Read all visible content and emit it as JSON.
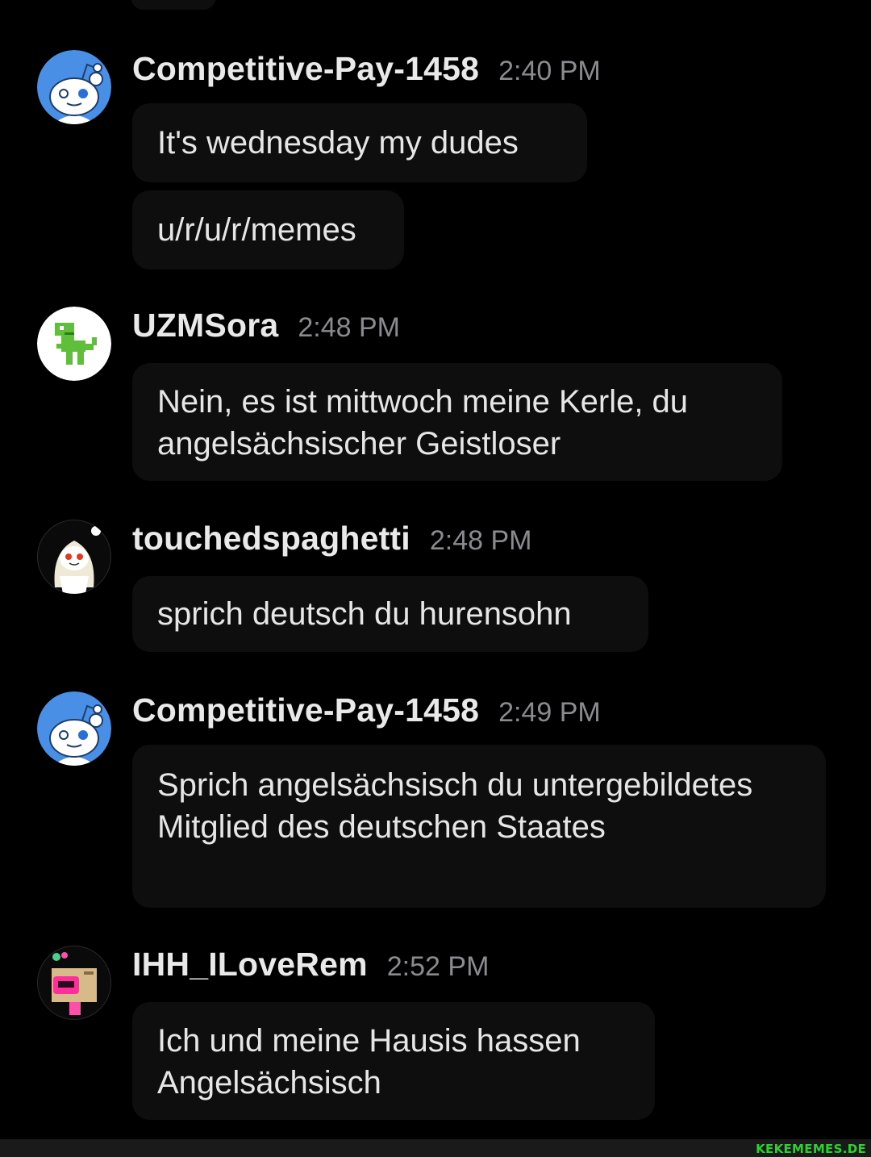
{
  "messages": [
    {
      "username": "Competitive-Pay-1458",
      "time": "2:40 PM",
      "avatar": "reddit-snoo-blue-icon",
      "bubbles": [
        "It's wednesday my dudes",
        "u/r/u/r/memes"
      ]
    },
    {
      "username": "UZMSora",
      "time": "2:48 PM",
      "avatar": "pixel-dinosaur-icon",
      "bubbles": [
        "Nein, es ist mittwoch meine Kerle, du angelsächsischer Geistloser"
      ]
    },
    {
      "username": "touchedspaghetti",
      "time": "2:48 PM",
      "avatar": "anime-snoo-icon",
      "bubbles": [
        "sprich deutsch du hurensohn"
      ]
    },
    {
      "username": "Competitive-Pay-1458",
      "time": "2:49 PM",
      "avatar": "reddit-snoo-blue-icon",
      "bubbles": [
        "Sprich angelsächsisch du untergebildetes Mitglied des deutschen Staates"
      ]
    },
    {
      "username": "IHH_ILoveRem",
      "time": "2:52 PM",
      "avatar": "box-head-snoo-icon",
      "bubbles": [
        "Ich und meine Hausis hassen Angelsächsisch"
      ]
    }
  ],
  "watermark": "KEKEMEMES.DE",
  "colors": {
    "background": "#000000",
    "bubble": "#0e0e0f",
    "username": "#e9e9ea",
    "timestamp": "#8b8b8f",
    "snoo_blue": "#4a8fe6",
    "watermark": "#27d52b"
  }
}
